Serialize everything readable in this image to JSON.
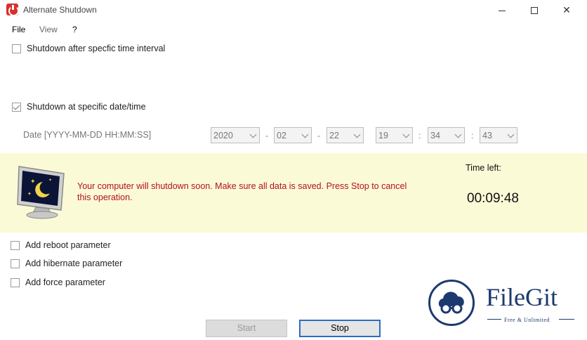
{
  "window": {
    "title": "Alternate Shutdown",
    "icon": "power-icon"
  },
  "menu": {
    "file": "File",
    "view": "View",
    "help": "?"
  },
  "options": {
    "interval": {
      "label": "Shutdown after specfic time interval",
      "checked": false
    },
    "specific": {
      "label": "Shutdown at specific date/time",
      "checked": true
    }
  },
  "date": {
    "label": "Date [YYYY-MM-DD HH:MM:SS]",
    "year": "2020",
    "month": "02",
    "day": "22",
    "hour": "19",
    "minute": "34",
    "second": "43",
    "date_sep": "-",
    "time_sep": ":"
  },
  "warning": {
    "message": "Your computer will shutdown soon. Make sure all data is saved. Press Stop to cancel this operation.",
    "time_left_label": "Time left:",
    "time_left": "00:09:48",
    "color": "#b3111a",
    "band_color": "#fbfad6"
  },
  "params": {
    "reboot": "Add reboot parameter",
    "hibernate": "Add hibernate parameter",
    "force": "Add force parameter"
  },
  "buttons": {
    "start": "Start",
    "stop": "Stop"
  },
  "watermark": {
    "title": "FileGit",
    "subtitle": "Free & Unlimited",
    "icon": "cloud-glasses-logo"
  }
}
